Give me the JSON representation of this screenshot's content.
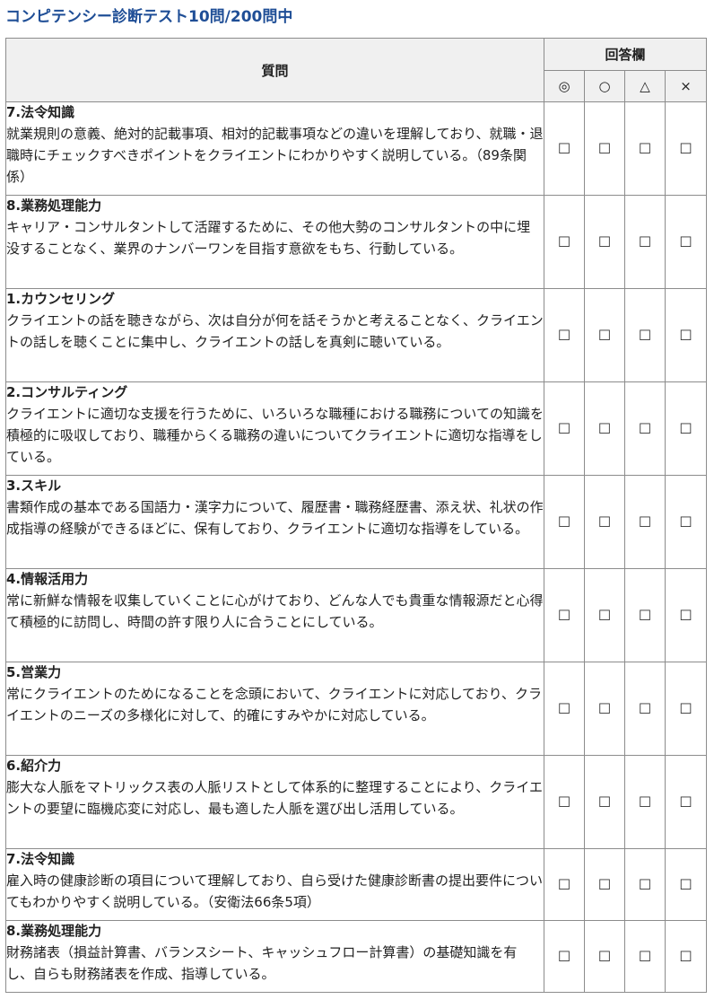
{
  "page": {
    "title": "コンピテンシー診断テスト10問/200問中"
  },
  "table": {
    "question_header": "質問",
    "answer_header": "回答欄",
    "options": [
      "◎",
      "○",
      "△",
      "×"
    ],
    "checkbox_glyph": "☐"
  },
  "questions": [
    {
      "title": "7.法令知識",
      "text": "就業規則の意義、絶対的記載事項、相対的記載事項などの違いを理解しており、就職・退職時にチェックすべきポイントをクライエントにわかりやすく説明している。（89条関係）"
    },
    {
      "title": "8.業務処理能力",
      "text": "キャリア・コンサルタントして活躍するために、その他大勢のコンサルタントの中に埋没することなく、業界のナンバーワンを目指す意欲をもち、行動している。"
    },
    {
      "title": "1.カウンセリング",
      "text": "クライエントの話を聴きながら、次は自分が何を話そうかと考えることなく、クライエントの話しを聴くことに集中し、クライエントの話しを真剣に聴いている。"
    },
    {
      "title": "2.コンサルティング",
      "text": "クライエントに適切な支援を行うために、いろいろな職種における職務についての知識を積極的に吸収しており、職種からくる職務の違いについてクライエントに適切な指導をしている。"
    },
    {
      "title": "3.スキル",
      "text": "書類作成の基本である国語力・漢字力について、履歴書・職務経歴書、添え状、礼状の作成指導の経験ができるほどに、保有しており、クライエントに適切な指導をしている。"
    },
    {
      "title": "4.情報活用力",
      "text": "常に新鮮な情報を収集していくことに心がけており、どんな人でも貴重な情報源だと心得て積極的に訪問し、時間の許す限り人に合うことにしている。"
    },
    {
      "title": "5.営業力",
      "text": "常にクライエントのためになることを念頭において、クライエントに対応しており、クライエントのニーズの多様化に対して、的確にすみやかに対応している。"
    },
    {
      "title": "6.紹介力",
      "text": "膨大な人脈をマトリックス表の人脈リストとして体系的に整理することにより、クライエントの要望に臨機応変に対応し、最も適した人脈を選び出し活用している。"
    },
    {
      "title": "7.法令知識",
      "text": "雇入時の健康診断の項目について理解しており、自ら受けた健康診断書の提出要件についてもわかりやすく説明している。（安衛法66条5項）"
    },
    {
      "title": "8.業務処理能力",
      "text": "財務諸表（損益計算書、バランスシート、キャッシュフロー計算書）の基礎知識を有し、自らも財務諸表を作成、指導している。"
    }
  ]
}
